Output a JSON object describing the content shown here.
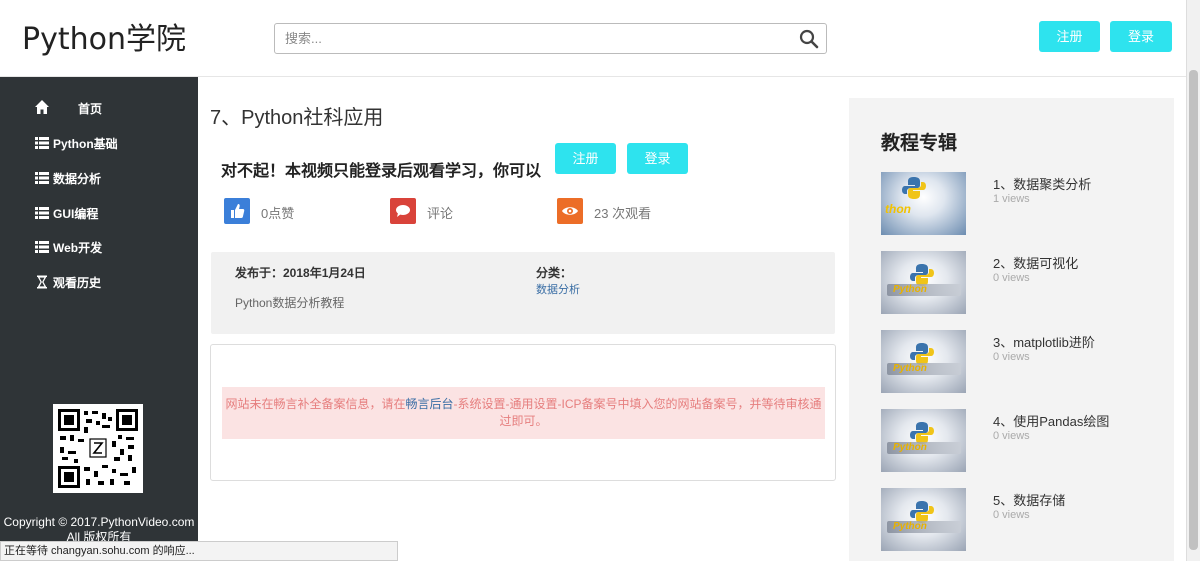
{
  "header": {
    "logo": "Python学院",
    "search_placeholder": "搜索...",
    "register_label": "注册",
    "login_label": "登录"
  },
  "sidebar": {
    "items": [
      {
        "label": "首页",
        "icon": "home-icon"
      },
      {
        "label": "Python基础",
        "icon": "list-icon"
      },
      {
        "label": "数据分析",
        "icon": "list-icon"
      },
      {
        "label": "GUI编程",
        "icon": "list-icon"
      },
      {
        "label": "Web开发",
        "icon": "list-icon"
      },
      {
        "label": "观看历史",
        "icon": "hourglass-icon"
      }
    ],
    "copyright_line1": "Copyright © 2017.PythonVideo.com",
    "copyright_line2": "All 版权所有"
  },
  "main": {
    "title": "7、Python社科应用",
    "notice": "对不起！本视频只能登录后观看学习，你可以",
    "register_label": "注册",
    "login_label": "登录",
    "stats": {
      "likes": "0点赞",
      "comments": "评论",
      "views": "23 次观看"
    },
    "published": "发布于：2018年1月24日",
    "description": "Python数据分析教程",
    "category_label": "分类：",
    "category_link": "数据分析",
    "alert_before": "网站未在畅言补全备案信息，请在",
    "alert_link": "畅言后台",
    "alert_after": "-系统设置-通用设置-ICP备案号中填入您的网站备案号，并等待审核通过即可。"
  },
  "right": {
    "title": "教程专辑",
    "courses": [
      {
        "title": "1、数据聚类分析",
        "views": "1 views"
      },
      {
        "title": "2、数据可视化",
        "views": "0 views"
      },
      {
        "title": "3、matplotlib进阶",
        "views": "0 views"
      },
      {
        "title": "4、使用Pandas绘图",
        "views": "0 views"
      },
      {
        "title": "5、数据存储",
        "views": "0 views"
      }
    ]
  },
  "statusbar": "正在等待 changyan.sohu.com 的响应...",
  "colors": {
    "accent": "#2ee3ee",
    "sidebar_bg": "#2f3437",
    "like_blue": "#3b7fd9",
    "comment_red": "#d9433a",
    "view_orange": "#ec6d27"
  }
}
